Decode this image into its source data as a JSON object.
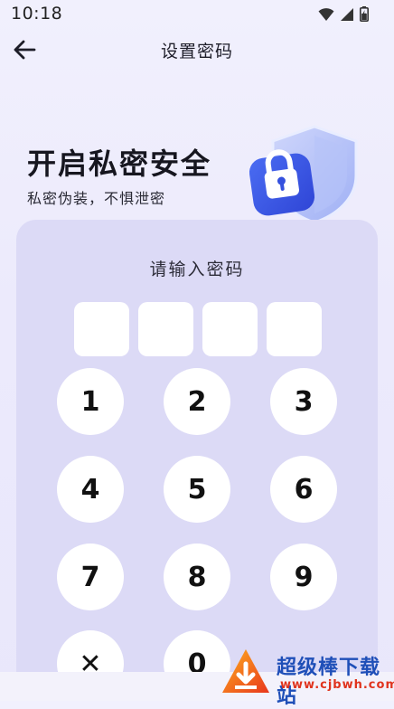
{
  "status_bar": {
    "time": "10:18",
    "icons": [
      "wifi-icon",
      "signal-icon",
      "battery-icon"
    ]
  },
  "header": {
    "title": "设置密码",
    "back_icon": "arrow-left-icon"
  },
  "hero": {
    "title": "开启私密安全",
    "subtitle": "私密伪装，不惧泄密",
    "illustration": "shield-lock-icon"
  },
  "keypad_panel": {
    "prompt": "请输入密码",
    "pin_length": 4,
    "entered_digits": 0,
    "keys": [
      {
        "label": "1"
      },
      {
        "label": "2"
      },
      {
        "label": "3"
      },
      {
        "label": "4"
      },
      {
        "label": "5"
      },
      {
        "label": "6"
      },
      {
        "label": "7"
      },
      {
        "label": "8"
      },
      {
        "label": "9"
      },
      {
        "label": "✕"
      },
      {
        "label": "0"
      }
    ]
  },
  "watermark": {
    "text": "超级棒下载站",
    "url": "www.cjbwh.com"
  },
  "colors": {
    "background": "#eeedfc",
    "panel": "#dcdaf6",
    "key": "#ffffff",
    "shield_blue": "#3f5ee8"
  }
}
